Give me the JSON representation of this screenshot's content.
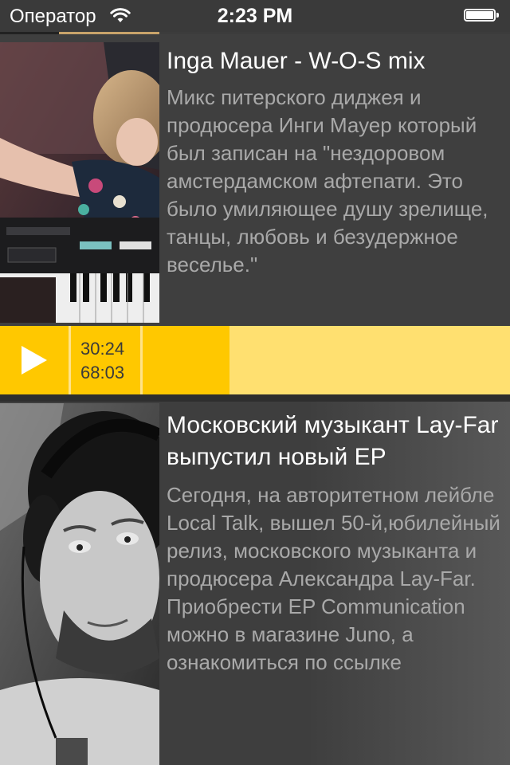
{
  "status_bar": {
    "carrier": "Оператор",
    "time": "2:23 PM"
  },
  "feed": [
    {
      "title": "Inga Mauer - W-O-S mix",
      "description": "Микс питерского диджея и продюсера Инги Мауер который был записан на \"нездоровом амстердамском афтепати. Это было умиляющее душу зрелище, танцы, любовь и безудержное веселье.\""
    },
    {
      "title": "Московский музыкант Lay-Far выпустил новый EP",
      "description": "Сегодня, на авторитетном лейбле Local Talk, вышел 50-й,юбилейный релиз, московского музыканта и продюсера Александра Lay-Far. Приобрести EP Communication можно в магазине Juno, а ознакомиться по ссылке"
    }
  ],
  "player": {
    "elapsed": "30:24",
    "duration": "68:03",
    "progress_fraction": 0.45
  },
  "colors": {
    "background": "#3c3c3c",
    "accent": "#ffc800",
    "accent_light": "#ffe070",
    "secondary_text": "#a9a9a9"
  },
  "icons": [
    "wifi-icon",
    "battery-icon",
    "play-icon"
  ]
}
